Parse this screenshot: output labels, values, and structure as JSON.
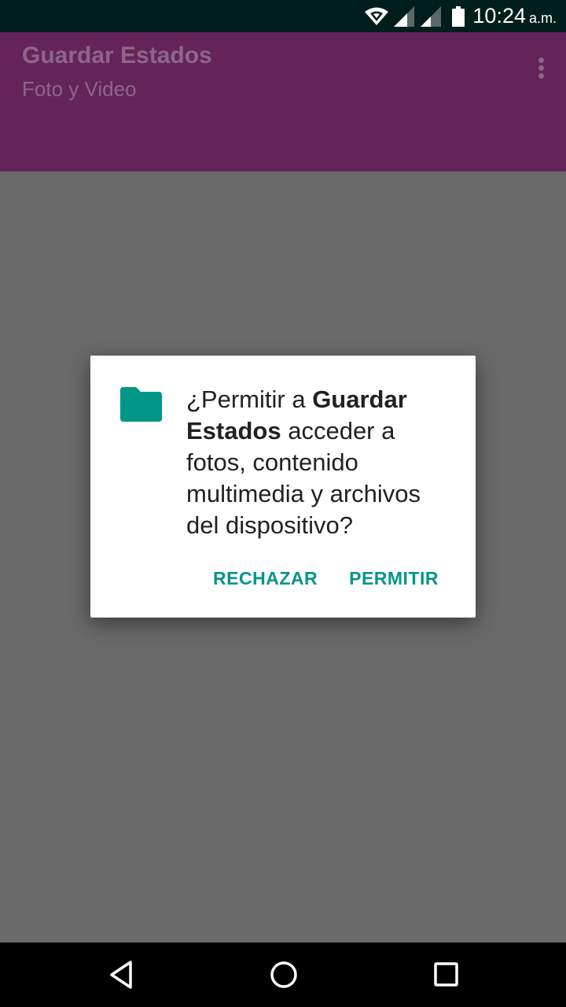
{
  "status_bar": {
    "time": "10:24",
    "ampm": "a.m.",
    "icons": [
      "wifi-icon",
      "signal-icon",
      "signal-icon",
      "battery-icon"
    ]
  },
  "app_bar": {
    "title": "Guardar Estados",
    "subtitle": "Foto y Video",
    "background_color": "#64245a"
  },
  "dialog": {
    "icon": "folder-icon",
    "message_prefix": "¿Permitir a ",
    "app_name": "Guardar Estados",
    "message_suffix": " acceder a fotos, contenido multimedia y archivos del dispositivo?",
    "deny_label": "RECHAZAR",
    "allow_label": "PERMITIR",
    "accent_color": "#009688"
  },
  "nav_bar": {
    "buttons": [
      "back-icon",
      "home-icon",
      "recents-icon"
    ]
  }
}
